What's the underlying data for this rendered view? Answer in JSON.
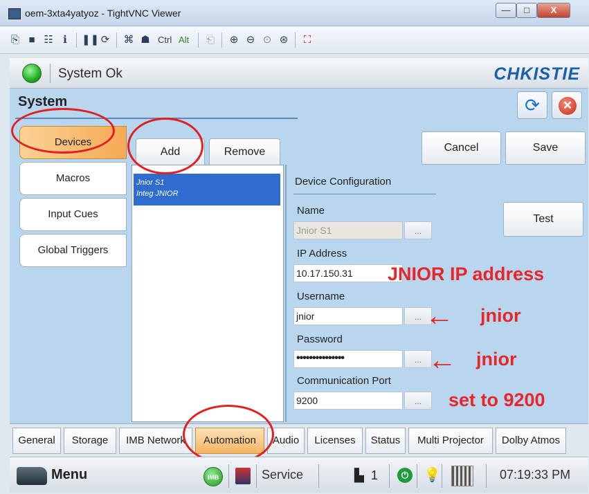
{
  "window": {
    "title": "oem-3xta4yatyoz - TightVNC Viewer",
    "controls": {
      "minimize": "—",
      "maximize": "□",
      "close": "X"
    }
  },
  "toolbar": {
    "ctrl_label": "Ctrl",
    "alt_label": "Alt",
    "icons": [
      "new-connection-icon",
      "save-icon",
      "options-icon",
      "info-icon",
      "pause-icon",
      "refresh-icon",
      "ctrl-alt-del-icon",
      "ctrl-esc-icon",
      "ctrl-key-icon",
      "alt-key-icon",
      "clipboard-icon",
      "zoom-in-icon",
      "zoom-out-icon",
      "zoom-100-icon",
      "zoom-fit-icon",
      "fullscreen-icon"
    ]
  },
  "status": {
    "text": "System Ok",
    "brand": "CHKISTIE"
  },
  "panel": {
    "title": "System",
    "side_tabs": [
      "Devices",
      "Macros",
      "Input Cues",
      "Global Triggers"
    ],
    "active_side_tab": "Devices",
    "list_actions": {
      "add": "Add",
      "remove": "Remove"
    },
    "device_list": {
      "selected_lines": [
        "Jnior S1",
        "Integ JNIOR"
      ]
    },
    "actions": {
      "cancel": "Cancel",
      "save": "Save",
      "test": "Test"
    },
    "config": {
      "heading": "Device Configuration",
      "name_label": "Name",
      "name_value": "Jnior S1",
      "ip_label": "IP Address",
      "ip_value": "10.17.150.31",
      "username_label": "Username",
      "username_value": "jnior",
      "password_label": "Password",
      "password_value": "•••••••••••••••",
      "port_label": "Communication Port",
      "port_value": "9200",
      "ellipsis": "..."
    },
    "annotations": {
      "ip_note": "JNIOR IP address",
      "username_note": "jnior",
      "password_note": "jnior",
      "port_note": "set to 9200",
      "arrow": "←"
    }
  },
  "bottom_tabs": [
    "General",
    "Storage",
    "IMB Network",
    "Automation",
    "Audio",
    "Licenses",
    "Status",
    "Multi Projector",
    "Dolby Atmos"
  ],
  "active_bottom_tab": "Automation",
  "taskbar": {
    "menu_label": "Menu",
    "imb_label": "IMB",
    "service_label": "Service",
    "projector_count": "1",
    "clock": "07:19:33 PM"
  },
  "colors": {
    "annotation": "#e8262a",
    "selection": "#2f6ccf",
    "panel": "#b8d7ef",
    "active_tab": "#f5a955"
  }
}
